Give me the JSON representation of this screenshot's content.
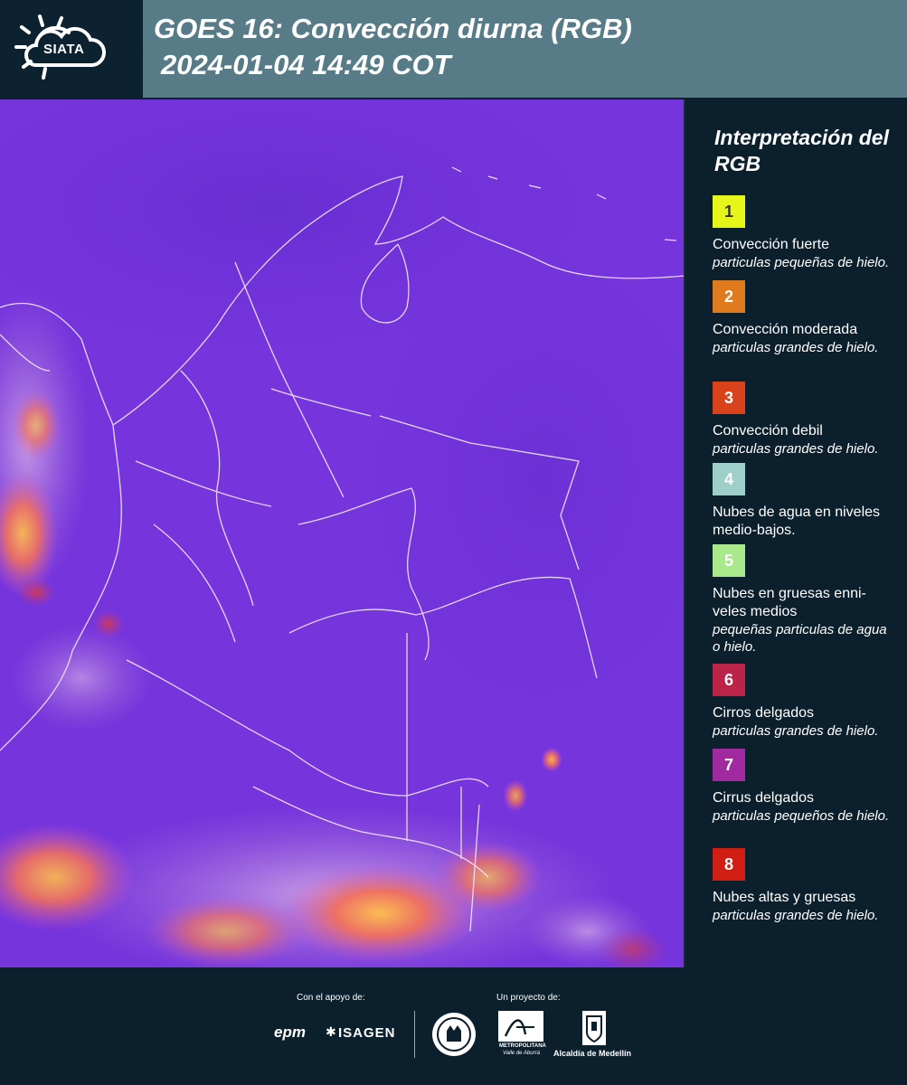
{
  "header": {
    "logo_text": "SIATA",
    "title_line1": "GOES 16: Convección diurna (RGB)",
    "title_line2": "2024-01-04 14:49 COT"
  },
  "legend": {
    "title": "Interpretación del RGB",
    "items": [
      {
        "number": "1",
        "color": "#e6f51a",
        "name": "Convección fuerte",
        "desc": "particulas pequeñas de hielo."
      },
      {
        "number": "2",
        "color": "#e07a1e",
        "name": "Convección moderada",
        "desc": "particulas grandes de hielo."
      },
      {
        "number": "3",
        "color": "#d9421a",
        "name": "Convección debil",
        "desc": "particulas grandes de hielo."
      },
      {
        "number": "4",
        "color": "#9ecfc9",
        "name": "Nubes de agua en niveles medio-bajos.",
        "desc": ""
      },
      {
        "number": "5",
        "color": "#a9e88b",
        "name": "Nubes en gruesas enni-veles medios",
        "desc": "pequeñas particulas de agua o hielo."
      },
      {
        "number": "6",
        "color": "#bb2348",
        "name": "Cirros delgados",
        "desc": "particulas grandes de hielo."
      },
      {
        "number": "7",
        "color": "#a12aa0",
        "name": "Cirrus delgados",
        "desc": "particulas pequeños de hielo."
      },
      {
        "number": "8",
        "color": "#d01e14",
        "name": "Nubes altas y gruesas",
        "desc": "particulas grandes de hielo."
      }
    ]
  },
  "footer": {
    "support_label": "Con el apoyo de:",
    "project_label": "Un proyecto de:",
    "sponsor1": "epm",
    "sponsor2": "ISAGEN",
    "partner1_line1": "METROPOLITANA",
    "partner1_line2": "Valle de Aburrá",
    "partner2": "Alcaldía de Medellín"
  }
}
